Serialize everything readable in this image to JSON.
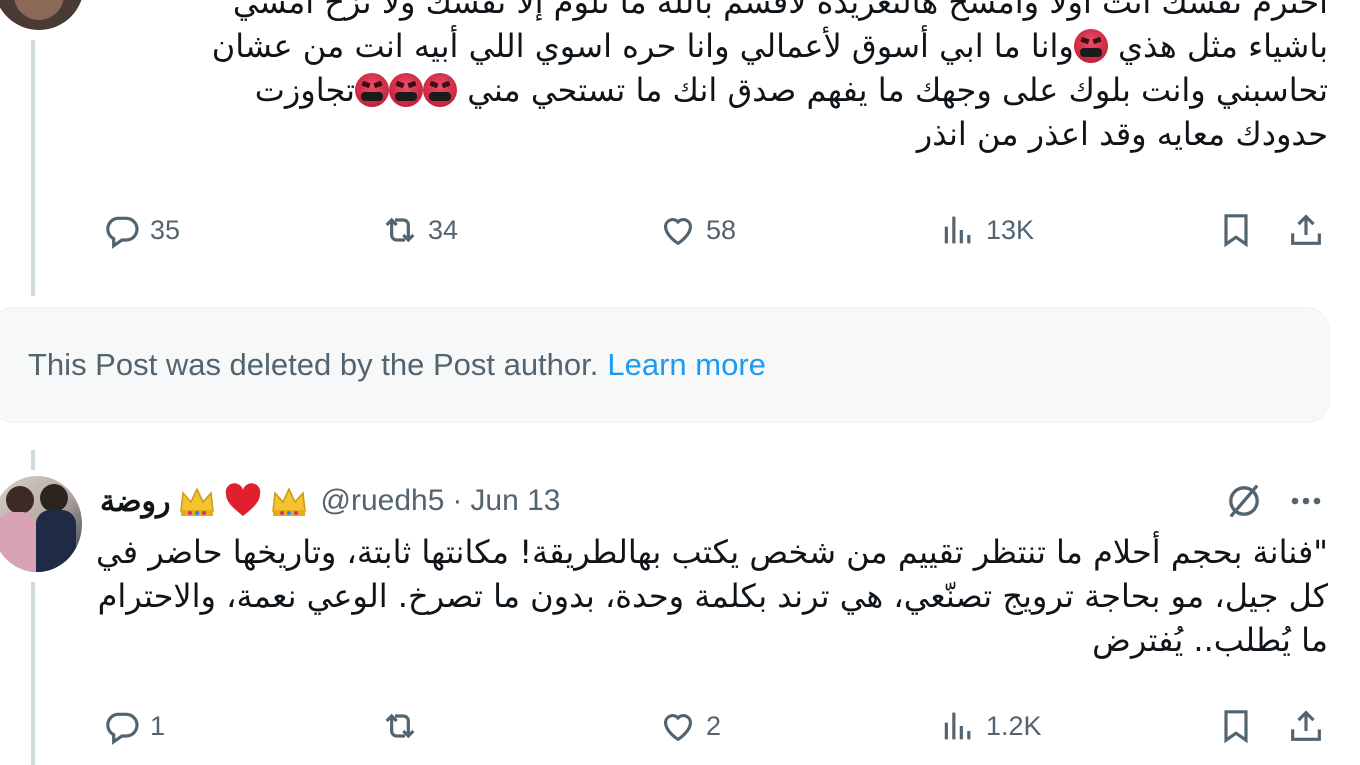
{
  "tweet1": {
    "text_lines": [
      "احترم نفسك انت اولا وامسح هالتغريده لاقسم بالله ما تلوم إلا نفسك ولا تزح امسي",
      "باشياء مثل هذي 🤬وانا ما ابي أسوق لأعمالي وانا حره اسوي اللي أبيه انت من عشان",
      "تحاسبني وانت بلوك على وجهك ما يفهم صدق انك ما تستحي مني 🤬🤬🤬تجاوزت",
      "حدودك معايه وقد اعذر من انذر"
    ],
    "line1": "احترم نفسك انت اولا وامسح هالتغريده لاقسم بالله ما تلوم إلا نفسك ولا تزح امسي",
    "line2_a": "باشياء مثل هذي ",
    "line2_b": "وانا ما ابي أسوق لأعمالي وانا حره اسوي اللي أبيه انت من عشان",
    "line3_a": "تحاسبني وانت بلوك على وجهك ما يفهم صدق انك ما تستحي مني ",
    "line3_b": "تجاوزت",
    "line4": "حدودك معايه وقد اعذر من انذر",
    "emoji": "face-with-symbols-on-mouth",
    "replies": "35",
    "reposts": "34",
    "likes": "58",
    "views": "13K"
  },
  "deleted_notice": {
    "message": "This Post was deleted by the Post author.",
    "link": "Learn more"
  },
  "tweet2": {
    "display_name": "روضة",
    "handle": "@ruedh5",
    "separator": "·",
    "date": "Jun 13",
    "text": "\"فنانة بحجم أحلام ما تنتظر تقييم من شخص يكتب بهالطريقة! مكانتها ثابتة، وتاريخها حاضر في كل جيل، مو بحاجة ترويج تصنّعي، هي ترند بكلمة وحدة، بدون ما تصرخ. الوعي نعمة، والاحترام ما يُطلب.. يُفترض",
    "replies": "1",
    "reposts": "",
    "likes": "2",
    "views": "1.2K"
  },
  "icons": {
    "reply": "reply-icon",
    "repost": "repost-icon",
    "like": "heart-icon",
    "views": "views-icon",
    "bookmark": "bookmark-icon",
    "share": "share-icon",
    "grok": "grok-icon",
    "more": "more-icon",
    "crown": "crown-emoji",
    "heart": "red-heart-emoji"
  },
  "colors": {
    "text": "#0f1419",
    "muted": "#536471",
    "link": "#1d9bf0",
    "thread_line": "#cfd9de",
    "deleted_bg": "#f7f9f9"
  }
}
